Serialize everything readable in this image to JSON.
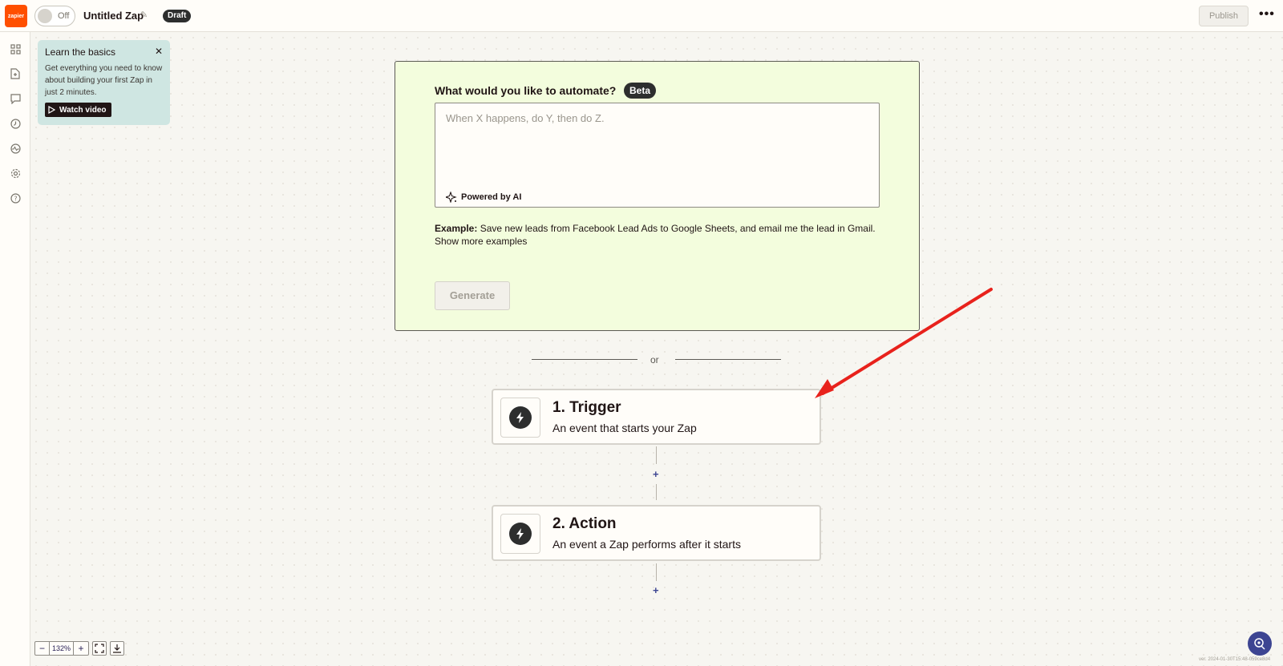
{
  "topbar": {
    "logo_text": "zapier",
    "toggle_label": "Off",
    "zap_title": "Untitled Zap",
    "status_badge": "Draft",
    "publish_label": "Publish",
    "more_label": "•••"
  },
  "rail": {
    "icons": [
      "apps-icon",
      "file-icon",
      "comment-icon",
      "history-icon",
      "activity-icon",
      "settings-icon",
      "help-icon"
    ]
  },
  "learn": {
    "title": "Learn the basics",
    "close_label": "✕",
    "body": "Get everything you need to know about building your first Zap in just 2 minutes.",
    "watch_label": "Watch video"
  },
  "ai": {
    "question": "What would you like to automate?",
    "badge": "Beta",
    "placeholder": "When X happens, do Y, then do Z.",
    "powered": "Powered by AI",
    "example_label": "Example:",
    "example_text": " Save new leads from Facebook Lead Ads to Google Sheets, and email me the lead in Gmail.",
    "show_more": "Show more examples",
    "generate_label": "Generate"
  },
  "divider": {
    "or": "or"
  },
  "steps": [
    {
      "title": "1. Trigger",
      "subtitle": "An event that starts your Zap"
    },
    {
      "title": "2. Action",
      "subtitle": "An event a Zap performs after it starts"
    }
  ],
  "plus_label": "+",
  "zoom": {
    "minus": "−",
    "value": "132%",
    "plus": "+"
  },
  "version": "ver. 2024-01-30T15:48-059ce8d4",
  "colors": {
    "brand": "#ff4f00",
    "ai_box_bg": "#f3fddd",
    "accent": "#3d4592",
    "annotation_arrow": "#e8221c"
  }
}
